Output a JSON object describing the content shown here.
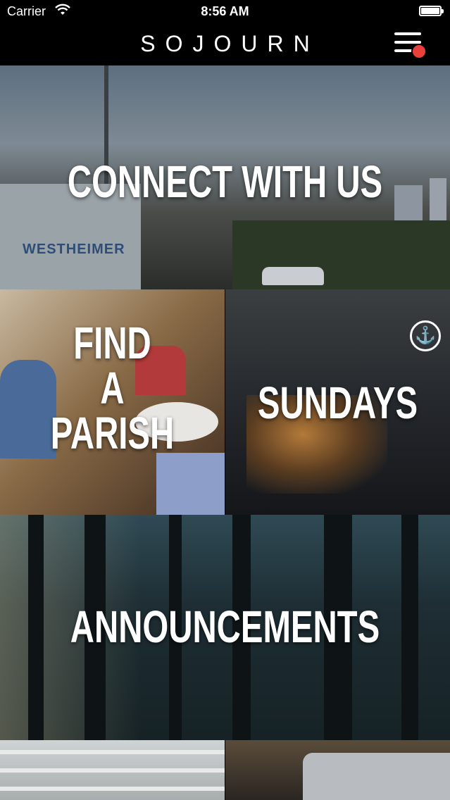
{
  "status_bar": {
    "carrier": "Carrier",
    "time": "8:56 AM",
    "battery_level": 1.0
  },
  "nav_bar": {
    "title": "SOJOURN",
    "menu_icon": "hamburger-menu-icon",
    "notification_dot_color": "#e8403a"
  },
  "tiles": {
    "connect": {
      "label": "CONNECT WITH US",
      "photo_sign_text": "WESTHEIMER"
    },
    "parish": {
      "label_line1": "FIND",
      "label_line2": "A",
      "label_line3": "PARISH"
    },
    "sundays": {
      "label": "SUNDAYS",
      "icon": "anchor-icon"
    },
    "announcements": {
      "label": "ANNOUNCEMENTS"
    }
  }
}
